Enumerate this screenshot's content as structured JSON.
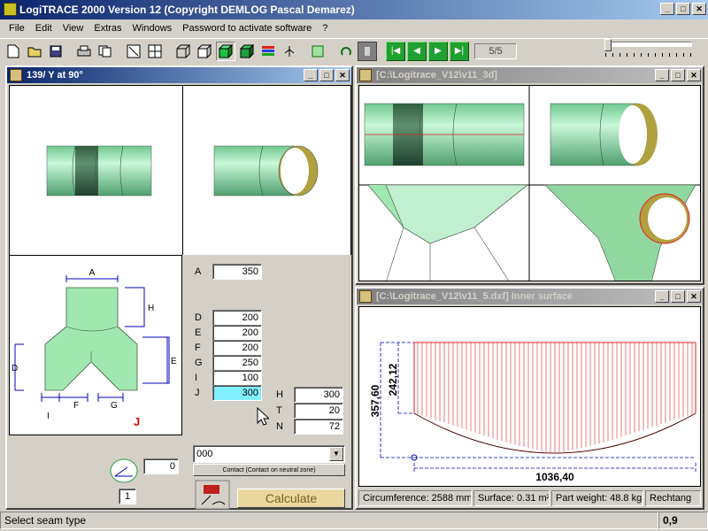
{
  "app": {
    "title": "LogiTRACE 2000  Version 12  (Copyright DEMLOG Pascal Demarez)"
  },
  "menu": [
    "File",
    "Edit",
    "View",
    "Extras",
    "Windows",
    "Password to activate software",
    "?"
  ],
  "toolbar": {
    "page": "5/5"
  },
  "left_window": {
    "title": "139/ Y at 90°",
    "diagram_labels": {
      "A": "A",
      "H": "H",
      "D": "D",
      "E": "E",
      "F": "F",
      "G": "G",
      "I": "I",
      "J": "J"
    },
    "params": [
      {
        "label": "A",
        "value": "350"
      },
      {
        "label": "D",
        "value": "200"
      },
      {
        "label": "E",
        "value": "200"
      },
      {
        "label": "F",
        "value": "200"
      },
      {
        "label": "G",
        "value": "250"
      },
      {
        "label": "I",
        "value": "100"
      },
      {
        "label": "J",
        "value": "300"
      }
    ],
    "params2": [
      {
        "label": "H",
        "value": "300"
      },
      {
        "label": "T",
        "value": "20"
      },
      {
        "label": "N",
        "value": "72"
      }
    ],
    "seam_value": "000",
    "contact_label": "Contact (Contact on neutral zone)",
    "calculate_label": "Calculate",
    "angle_value": "0",
    "count_value": "1"
  },
  "right_top_window": {
    "title": "[C:\\Logitrace_V12\\v11_3d]"
  },
  "right_bottom_window": {
    "title": "[C:\\Logitrace_V12\\v11_5.dxf]  Inner surface",
    "dim_height_outer": "357,60",
    "dim_height_inner": "242,12",
    "dim_width": "1036,40",
    "info": [
      "Circumference: 2588 mm",
      "Surface: 0.31 m²",
      "Part weight: 48.8 kg",
      "Rechtang"
    ]
  },
  "status": {
    "message": "Select seam type",
    "value": "0,9"
  },
  "colors": {
    "accent": "#0a246a",
    "pipe": "#a0e8b0",
    "highlight": "#80f0ff"
  }
}
